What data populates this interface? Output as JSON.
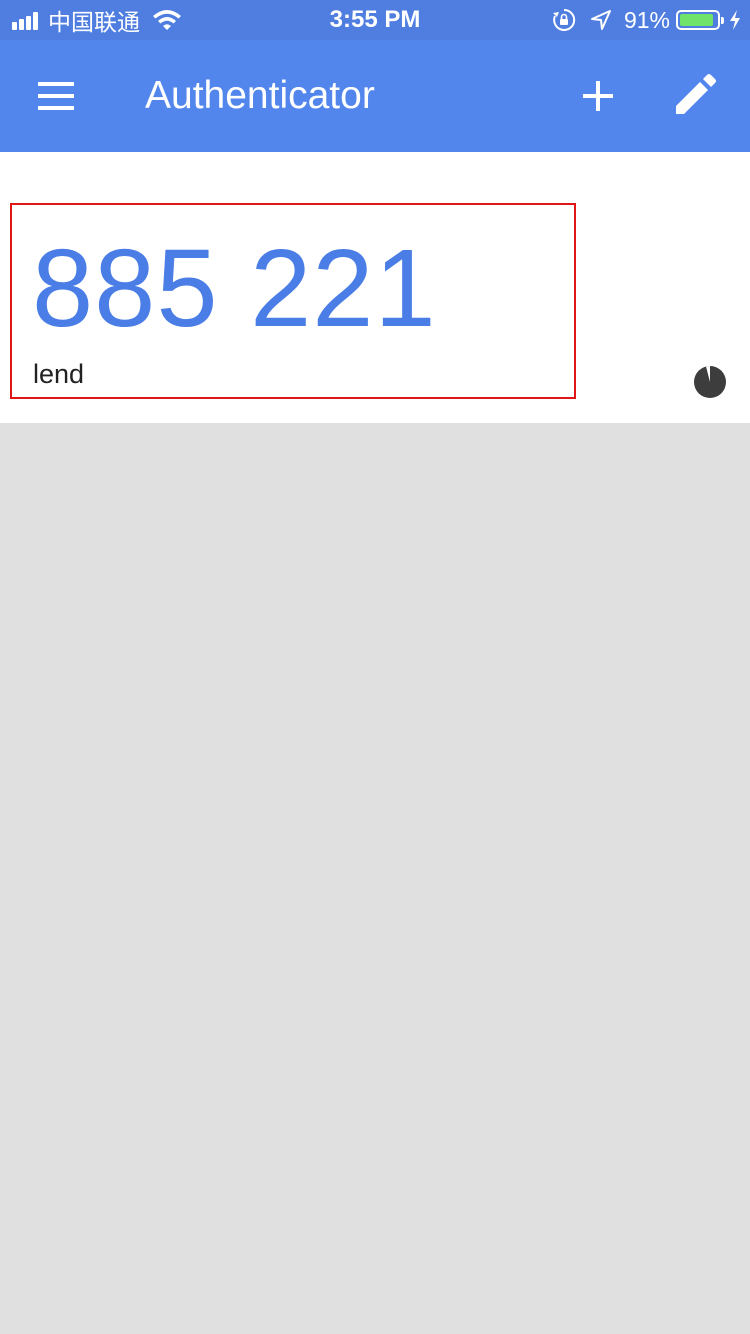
{
  "status_bar": {
    "carrier": "中国联通",
    "time": "3:55 PM",
    "battery_percent": "91%",
    "battery_level": 0.91,
    "icons": [
      "signal-icon",
      "wifi-icon",
      "rotation-lock-icon",
      "location-arrow-icon",
      "battery-icon",
      "charging-bolt-icon"
    ]
  },
  "app_bar": {
    "title": "Authenticator",
    "icons": [
      "menu-icon",
      "add-icon",
      "edit-pencil-icon"
    ],
    "background": "#5286ec"
  },
  "accounts": [
    {
      "code": "885 221",
      "name": "lend",
      "timer_icon": "countdown-timer-icon"
    }
  ],
  "colors": {
    "code": "#4a7ee6",
    "highlight_box": "#e01515",
    "list_background": "#e0e0e0"
  }
}
